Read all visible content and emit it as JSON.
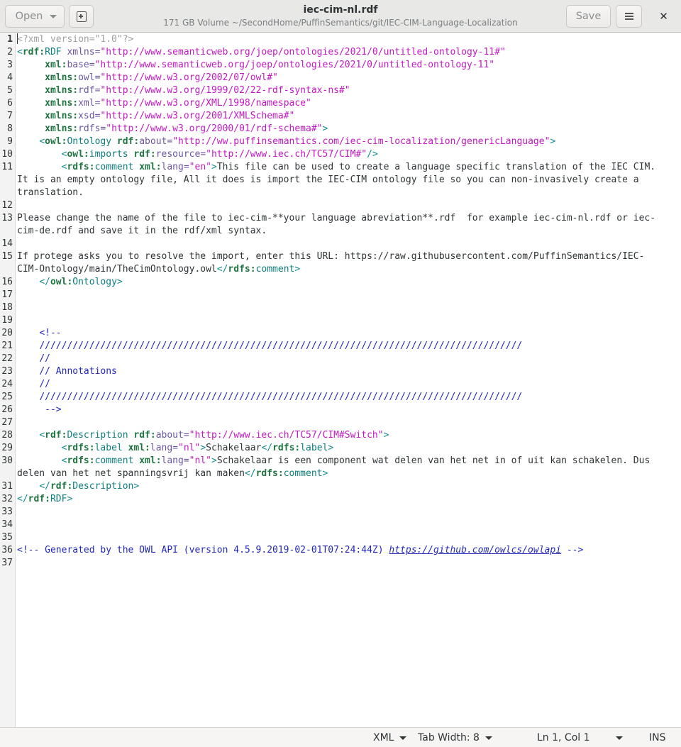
{
  "window": {
    "title": "iec-cim-nl.rdf",
    "subtitle": "171 GB Volume ~/SecondHome/PuffinSemantics/git/IEC-CIM-Language-Localization"
  },
  "toolbar": {
    "open_label": "Open",
    "save_label": "Save"
  },
  "editor": {
    "line_numbers": [
      "1",
      "2",
      "3",
      "4",
      "5",
      "6",
      "7",
      "8",
      "9",
      "10",
      "11",
      "",
      "",
      "12",
      "13",
      "",
      "14",
      "15",
      "",
      "16",
      "17",
      "18",
      "19",
      "20",
      "21",
      "22",
      "23",
      "24",
      "25",
      "26",
      "27",
      "28",
      "29",
      "30",
      "",
      "31",
      "32",
      "33",
      "34",
      "35",
      "36",
      "37"
    ],
    "current_line": "1",
    "lines": [
      [
        [
          "pi",
          "<?xml version=\"1.0\"?>"
        ]
      ],
      [
        [
          "tag",
          "<"
        ],
        [
          "ns",
          "rdf:"
        ],
        [
          "el",
          "RDF "
        ],
        [
          "at",
          "xmlns="
        ],
        [
          "str",
          "\"http://www.semanticweb.org/joep/ontologies/2021/0/untitled-ontology-11#\""
        ]
      ],
      [
        [
          "",
          "     "
        ],
        [
          "ns",
          "xml:"
        ],
        [
          "at",
          "base="
        ],
        [
          "str",
          "\"http://www.semanticweb.org/joep/ontologies/2021/0/untitled-ontology-11\""
        ]
      ],
      [
        [
          "",
          "     "
        ],
        [
          "ns",
          "xmlns:"
        ],
        [
          "at",
          "owl="
        ],
        [
          "str",
          "\"http://www.w3.org/2002/07/owl#\""
        ]
      ],
      [
        [
          "",
          "     "
        ],
        [
          "ns",
          "xmlns:"
        ],
        [
          "at",
          "rdf="
        ],
        [
          "str",
          "\"http://www.w3.org/1999/02/22-rdf-syntax-ns#\""
        ]
      ],
      [
        [
          "",
          "     "
        ],
        [
          "ns",
          "xmlns:"
        ],
        [
          "at",
          "xml="
        ],
        [
          "str",
          "\"http://www.w3.org/XML/1998/namespace\""
        ]
      ],
      [
        [
          "",
          "     "
        ],
        [
          "ns",
          "xmlns:"
        ],
        [
          "at",
          "xsd="
        ],
        [
          "str",
          "\"http://www.w3.org/2001/XMLSchema#\""
        ]
      ],
      [
        [
          "",
          "     "
        ],
        [
          "ns",
          "xmlns:"
        ],
        [
          "at",
          "rdfs="
        ],
        [
          "str",
          "\"http://www.w3.org/2000/01/rdf-schema#\""
        ],
        [
          "tag",
          ">"
        ]
      ],
      [
        [
          "",
          "    "
        ],
        [
          "tag",
          "<"
        ],
        [
          "ns",
          "owl:"
        ],
        [
          "el",
          "Ontology "
        ],
        [
          "ns",
          "rdf:"
        ],
        [
          "at",
          "about="
        ],
        [
          "str",
          "\"http://ww.puffinsemantics.com/iec-cim-localization/genericLanguage\""
        ],
        [
          "tag",
          ">"
        ]
      ],
      [
        [
          "",
          "        "
        ],
        [
          "tag",
          "<"
        ],
        [
          "ns",
          "owl:"
        ],
        [
          "el",
          "imports "
        ],
        [
          "ns",
          "rdf:"
        ],
        [
          "at",
          "resource="
        ],
        [
          "str",
          "\"http://www.iec.ch/TC57/CIM#\""
        ],
        [
          "tag",
          "/>"
        ]
      ],
      [
        [
          "",
          "        "
        ],
        [
          "tag",
          "<"
        ],
        [
          "ns",
          "rdfs:"
        ],
        [
          "el",
          "comment "
        ],
        [
          "ns",
          "xml:"
        ],
        [
          "at",
          "lang="
        ],
        [
          "str",
          "\"en\""
        ],
        [
          "tag",
          ">"
        ],
        [
          "",
          "This file can be used to create a language specific translation of the IEC CIM."
        ]
      ],
      [
        [
          "",
          "It is an empty ontology file, All it does is import the IEC-CIM ontology file so you can non-invasively create a"
        ]
      ],
      [
        [
          "",
          "translation."
        ]
      ],
      [
        [
          "",
          ""
        ]
      ],
      [
        [
          "",
          "Please change the name of the file to iec-cim-**your language abreviation**.rdf  for example iec-cim-nl.rdf or iec-"
        ]
      ],
      [
        [
          "",
          "cim-de.rdf and save it in the rdf/xml syntax."
        ]
      ],
      [
        [
          "",
          ""
        ]
      ],
      [
        [
          "",
          "If protege asks you to resolve the import, enter this URL: https://raw.githubusercontent.com/PuffinSemantics/IEC-"
        ]
      ],
      [
        [
          "",
          "CIM-Ontology/main/TheCimOntology.owl"
        ],
        [
          "tag",
          "</"
        ],
        [
          "ns",
          "rdfs:"
        ],
        [
          "el",
          "comment"
        ],
        [
          "tag",
          ">"
        ]
      ],
      [
        [
          "",
          "    "
        ],
        [
          "tag",
          "</"
        ],
        [
          "ns",
          "owl:"
        ],
        [
          "el",
          "Ontology"
        ],
        [
          "tag",
          ">"
        ]
      ],
      [
        [
          "",
          ""
        ]
      ],
      [
        [
          "",
          ""
        ]
      ],
      [
        [
          "",
          ""
        ]
      ],
      [
        [
          "",
          "    "
        ],
        [
          "cm",
          "<!--"
        ]
      ],
      [
        [
          "",
          "    "
        ],
        [
          "cm",
          "///////////////////////////////////////////////////////////////////////////////////////"
        ]
      ],
      [
        [
          "",
          "    "
        ],
        [
          "cm",
          "//"
        ]
      ],
      [
        [
          "",
          "    "
        ],
        [
          "cm",
          "// Annotations"
        ]
      ],
      [
        [
          "",
          "    "
        ],
        [
          "cm",
          "//"
        ]
      ],
      [
        [
          "",
          "    "
        ],
        [
          "cm",
          "///////////////////////////////////////////////////////////////////////////////////////"
        ]
      ],
      [
        [
          "",
          "     "
        ],
        [
          "cm",
          "-->"
        ]
      ],
      [
        [
          "",
          ""
        ]
      ],
      [
        [
          "",
          "    "
        ],
        [
          "tag",
          "<"
        ],
        [
          "ns",
          "rdf:"
        ],
        [
          "el",
          "Description "
        ],
        [
          "ns",
          "rdf:"
        ],
        [
          "at",
          "about="
        ],
        [
          "str",
          "\"http://www.iec.ch/TC57/CIM#Switch\""
        ],
        [
          "tag",
          ">"
        ]
      ],
      [
        [
          "",
          "        "
        ],
        [
          "tag",
          "<"
        ],
        [
          "ns",
          "rdfs:"
        ],
        [
          "el",
          "label "
        ],
        [
          "ns",
          "xml:"
        ],
        [
          "at",
          "lang="
        ],
        [
          "str",
          "\"nl\""
        ],
        [
          "tag",
          ">"
        ],
        [
          "",
          "Schakelaar"
        ],
        [
          "tag",
          "</"
        ],
        [
          "ns",
          "rdfs:"
        ],
        [
          "el",
          "label"
        ],
        [
          "tag",
          ">"
        ]
      ],
      [
        [
          "",
          "        "
        ],
        [
          "tag",
          "<"
        ],
        [
          "ns",
          "rdfs:"
        ],
        [
          "el",
          "comment "
        ],
        [
          "ns",
          "xml:"
        ],
        [
          "at",
          "lang="
        ],
        [
          "str",
          "\"nl\""
        ],
        [
          "tag",
          ">"
        ],
        [
          "",
          "Schakelaar is een component wat delen van het net in of uit kan schakelen. Dus"
        ]
      ],
      [
        [
          "",
          "delen van het net spanningsvrij kan maken"
        ],
        [
          "tag",
          "</"
        ],
        [
          "ns",
          "rdfs:"
        ],
        [
          "el",
          "comment"
        ],
        [
          "tag",
          ">"
        ]
      ],
      [
        [
          "",
          "    "
        ],
        [
          "tag",
          "</"
        ],
        [
          "ns",
          "rdf:"
        ],
        [
          "el",
          "Description"
        ],
        [
          "tag",
          ">"
        ]
      ],
      [
        [
          "tag",
          "</"
        ],
        [
          "ns",
          "rdf:"
        ],
        [
          "el",
          "RDF"
        ],
        [
          "tag",
          ">"
        ]
      ],
      [
        [
          "",
          ""
        ]
      ],
      [
        [
          "",
          ""
        ]
      ],
      [
        [
          "",
          ""
        ]
      ],
      [
        [
          "cm",
          "<!-- Generated by the OWL API (version 4.5.9.2019-02-01T07:24:44Z) "
        ],
        [
          "lnk",
          "https://github.com/owlcs/owlapi"
        ],
        [
          "cm",
          " -->"
        ]
      ],
      [
        [
          "",
          ""
        ]
      ]
    ]
  },
  "statusbar": {
    "language": "XML",
    "tab_width": "Tab Width: 8",
    "position": "Ln 1, Col 1",
    "mode": "INS"
  }
}
